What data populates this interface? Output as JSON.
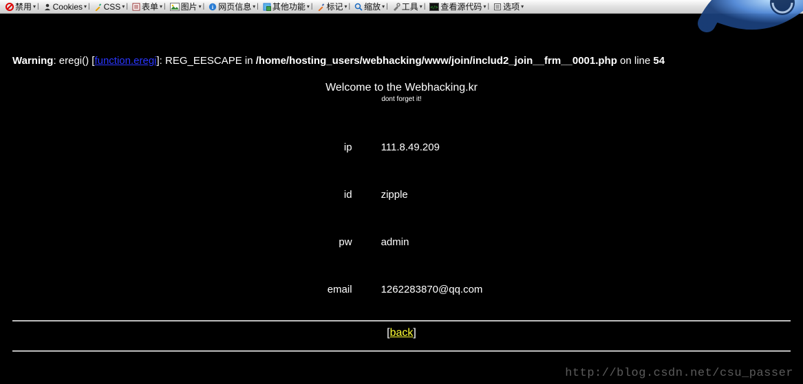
{
  "toolbar": {
    "items": [
      {
        "label": "禁用",
        "icon": "ban"
      },
      {
        "label": "Cookies",
        "icon": "user"
      },
      {
        "label": "CSS",
        "icon": "pencil"
      },
      {
        "label": "表单",
        "icon": "form"
      },
      {
        "label": "图片",
        "icon": "image"
      },
      {
        "label": "网页信息",
        "icon": "info"
      },
      {
        "label": "其他功能",
        "icon": "folder"
      },
      {
        "label": "标记",
        "icon": "marker"
      },
      {
        "label": "缩放",
        "icon": "zoom"
      },
      {
        "label": "工具",
        "icon": "tools"
      },
      {
        "label": "查看源代码",
        "icon": "source"
      },
      {
        "label": "选项",
        "icon": "options"
      }
    ]
  },
  "warning": {
    "prefix": "Warning",
    "func_text": ": eregi() [",
    "link_text": "function.eregi",
    "after_link": "]: REG_EESCAPE in ",
    "path": "/home/hosting_users/webhacking/www/join/includ2_join__frm__0001.php",
    "on_line": " on line ",
    "line_no": "54"
  },
  "welcome": {
    "title": "Welcome to the Webhacking.kr",
    "sub": "dont forget it!"
  },
  "info": {
    "rows": [
      {
        "label": "ip",
        "value": "111.8.49.209"
      },
      {
        "label": "id",
        "value": "zipple"
      },
      {
        "label": "pw",
        "value": "admin"
      },
      {
        "label": "email",
        "value": "1262283870@qq.com"
      }
    ]
  },
  "back": {
    "open": "[",
    "text": "back",
    "close": "]"
  },
  "watermark": "http://blog.csdn.net/csu_passer"
}
